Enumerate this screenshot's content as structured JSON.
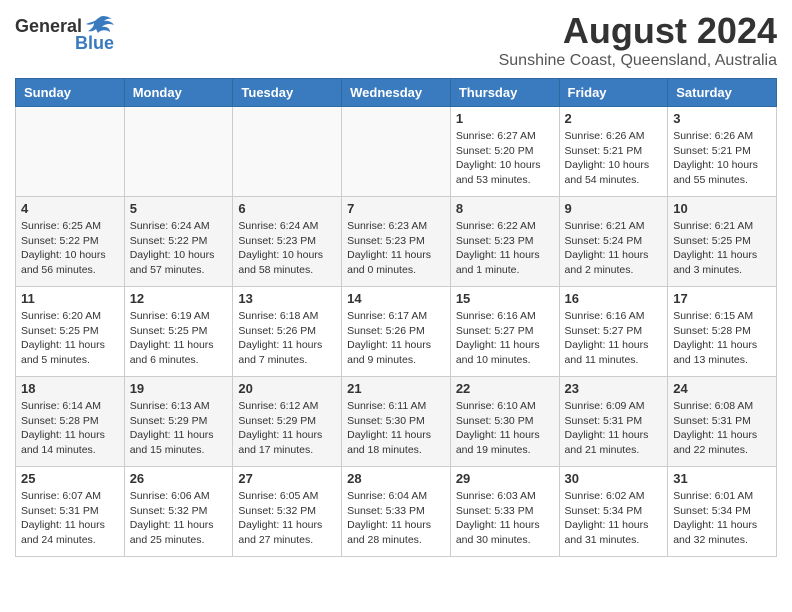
{
  "header": {
    "logo_general": "General",
    "logo_blue": "Blue",
    "main_title": "August 2024",
    "sub_title": "Sunshine Coast, Queensland, Australia"
  },
  "days_of_week": [
    "Sunday",
    "Monday",
    "Tuesday",
    "Wednesday",
    "Thursday",
    "Friday",
    "Saturday"
  ],
  "weeks": [
    [
      {
        "day": "",
        "info": ""
      },
      {
        "day": "",
        "info": ""
      },
      {
        "day": "",
        "info": ""
      },
      {
        "day": "",
        "info": ""
      },
      {
        "day": "1",
        "info": "Sunrise: 6:27 AM\nSunset: 5:20 PM\nDaylight: 10 hours\nand 53 minutes."
      },
      {
        "day": "2",
        "info": "Sunrise: 6:26 AM\nSunset: 5:21 PM\nDaylight: 10 hours\nand 54 minutes."
      },
      {
        "day": "3",
        "info": "Sunrise: 6:26 AM\nSunset: 5:21 PM\nDaylight: 10 hours\nand 55 minutes."
      }
    ],
    [
      {
        "day": "4",
        "info": "Sunrise: 6:25 AM\nSunset: 5:22 PM\nDaylight: 10 hours\nand 56 minutes."
      },
      {
        "day": "5",
        "info": "Sunrise: 6:24 AM\nSunset: 5:22 PM\nDaylight: 10 hours\nand 57 minutes."
      },
      {
        "day": "6",
        "info": "Sunrise: 6:24 AM\nSunset: 5:23 PM\nDaylight: 10 hours\nand 58 minutes."
      },
      {
        "day": "7",
        "info": "Sunrise: 6:23 AM\nSunset: 5:23 PM\nDaylight: 11 hours\nand 0 minutes."
      },
      {
        "day": "8",
        "info": "Sunrise: 6:22 AM\nSunset: 5:23 PM\nDaylight: 11 hours\nand 1 minute."
      },
      {
        "day": "9",
        "info": "Sunrise: 6:21 AM\nSunset: 5:24 PM\nDaylight: 11 hours\nand 2 minutes."
      },
      {
        "day": "10",
        "info": "Sunrise: 6:21 AM\nSunset: 5:25 PM\nDaylight: 11 hours\nand 3 minutes."
      }
    ],
    [
      {
        "day": "11",
        "info": "Sunrise: 6:20 AM\nSunset: 5:25 PM\nDaylight: 11 hours\nand 5 minutes."
      },
      {
        "day": "12",
        "info": "Sunrise: 6:19 AM\nSunset: 5:25 PM\nDaylight: 11 hours\nand 6 minutes."
      },
      {
        "day": "13",
        "info": "Sunrise: 6:18 AM\nSunset: 5:26 PM\nDaylight: 11 hours\nand 7 minutes."
      },
      {
        "day": "14",
        "info": "Sunrise: 6:17 AM\nSunset: 5:26 PM\nDaylight: 11 hours\nand 9 minutes."
      },
      {
        "day": "15",
        "info": "Sunrise: 6:16 AM\nSunset: 5:27 PM\nDaylight: 11 hours\nand 10 minutes."
      },
      {
        "day": "16",
        "info": "Sunrise: 6:16 AM\nSunset: 5:27 PM\nDaylight: 11 hours\nand 11 minutes."
      },
      {
        "day": "17",
        "info": "Sunrise: 6:15 AM\nSunset: 5:28 PM\nDaylight: 11 hours\nand 13 minutes."
      }
    ],
    [
      {
        "day": "18",
        "info": "Sunrise: 6:14 AM\nSunset: 5:28 PM\nDaylight: 11 hours\nand 14 minutes."
      },
      {
        "day": "19",
        "info": "Sunrise: 6:13 AM\nSunset: 5:29 PM\nDaylight: 11 hours\nand 15 minutes."
      },
      {
        "day": "20",
        "info": "Sunrise: 6:12 AM\nSunset: 5:29 PM\nDaylight: 11 hours\nand 17 minutes."
      },
      {
        "day": "21",
        "info": "Sunrise: 6:11 AM\nSunset: 5:30 PM\nDaylight: 11 hours\nand 18 minutes."
      },
      {
        "day": "22",
        "info": "Sunrise: 6:10 AM\nSunset: 5:30 PM\nDaylight: 11 hours\nand 19 minutes."
      },
      {
        "day": "23",
        "info": "Sunrise: 6:09 AM\nSunset: 5:31 PM\nDaylight: 11 hours\nand 21 minutes."
      },
      {
        "day": "24",
        "info": "Sunrise: 6:08 AM\nSunset: 5:31 PM\nDaylight: 11 hours\nand 22 minutes."
      }
    ],
    [
      {
        "day": "25",
        "info": "Sunrise: 6:07 AM\nSunset: 5:31 PM\nDaylight: 11 hours\nand 24 minutes."
      },
      {
        "day": "26",
        "info": "Sunrise: 6:06 AM\nSunset: 5:32 PM\nDaylight: 11 hours\nand 25 minutes."
      },
      {
        "day": "27",
        "info": "Sunrise: 6:05 AM\nSunset: 5:32 PM\nDaylight: 11 hours\nand 27 minutes."
      },
      {
        "day": "28",
        "info": "Sunrise: 6:04 AM\nSunset: 5:33 PM\nDaylight: 11 hours\nand 28 minutes."
      },
      {
        "day": "29",
        "info": "Sunrise: 6:03 AM\nSunset: 5:33 PM\nDaylight: 11 hours\nand 30 minutes."
      },
      {
        "day": "30",
        "info": "Sunrise: 6:02 AM\nSunset: 5:34 PM\nDaylight: 11 hours\nand 31 minutes."
      },
      {
        "day": "31",
        "info": "Sunrise: 6:01 AM\nSunset: 5:34 PM\nDaylight: 11 hours\nand 32 minutes."
      }
    ]
  ]
}
